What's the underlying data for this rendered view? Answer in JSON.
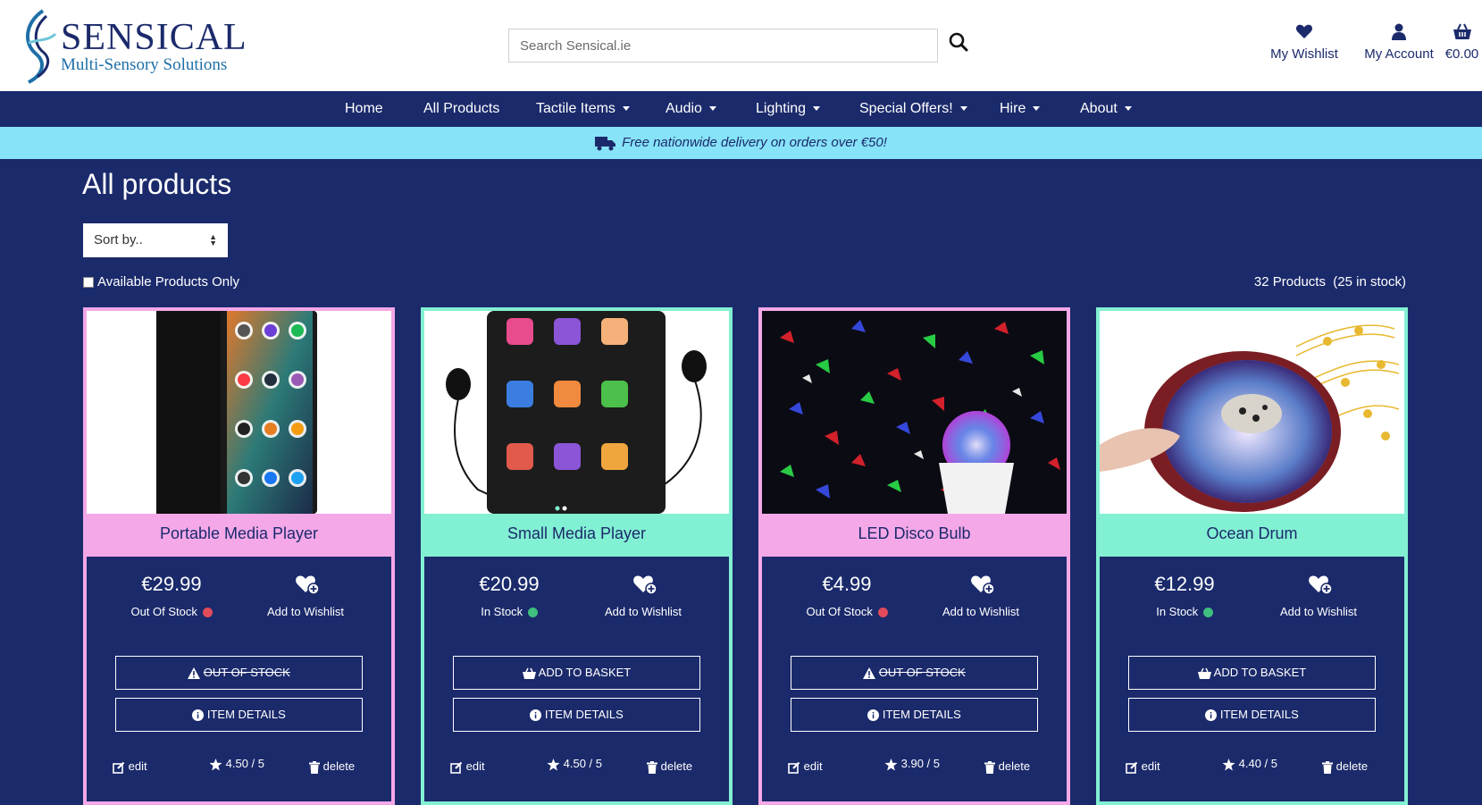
{
  "brand": {
    "name": "SENSICAL",
    "tagline": "Multi-Sensory Solutions"
  },
  "search": {
    "placeholder": "Search Sensical.ie"
  },
  "header_links": {
    "wishlist": "My Wishlist",
    "account": "My Account",
    "basket": "€0.00"
  },
  "nav": [
    {
      "label": "Home",
      "dropdown": false
    },
    {
      "label": "All Products",
      "dropdown": false
    },
    {
      "label": "Tactile Items",
      "dropdown": true
    },
    {
      "label": "Audio",
      "dropdown": true
    },
    {
      "label": "Lighting",
      "dropdown": true
    },
    {
      "label": "Special Offers!",
      "dropdown": true
    },
    {
      "label": "Hire",
      "dropdown": true
    },
    {
      "label": "About",
      "dropdown": true
    }
  ],
  "banner": "Free nationwide delivery on orders over €50!",
  "page": {
    "title": "All products",
    "sort_value": "Sort by..",
    "available_only_label": "Available Products Only",
    "product_count": "32 Products",
    "stock_count": "(25 in stock)"
  },
  "colors": {
    "navy": "#1b2a6b",
    "pink": "#f4a8e8",
    "mint": "#82f0d3",
    "banner": "#87e3f8"
  },
  "products": [
    {
      "name": "Portable Media Player",
      "price": "€29.99",
      "stock": "Out Of Stock",
      "in_stock": false,
      "wishlist_label": "Add to Wishlist",
      "primary_button": "Out of Stock",
      "details_button": "Item Details",
      "edit_label": "edit",
      "rating": "4.50 / 5",
      "delete_label": "delete",
      "theme": "pink"
    },
    {
      "name": "Small Media Player",
      "price": "€20.99",
      "stock": "In Stock",
      "in_stock": true,
      "wishlist_label": "Add to Wishlist",
      "primary_button": "Add to Basket",
      "details_button": "Item Details",
      "edit_label": "edit",
      "rating": "4.50 / 5",
      "delete_label": "delete",
      "theme": "mint"
    },
    {
      "name": "LED Disco Bulb",
      "price": "€4.99",
      "stock": "Out Of Stock",
      "in_stock": false,
      "wishlist_label": "Add to Wishlist",
      "primary_button": "Out of Stock",
      "details_button": "Item Details",
      "edit_label": "edit",
      "rating": "3.90 / 5",
      "delete_label": "delete",
      "theme": "pink"
    },
    {
      "name": "Ocean Drum",
      "price": "€12.99",
      "stock": "In Stock",
      "in_stock": true,
      "wishlist_label": "Add to Wishlist",
      "primary_button": "Add to Basket",
      "details_button": "Item Details",
      "edit_label": "edit",
      "rating": "4.40 / 5",
      "delete_label": "delete",
      "theme": "mint"
    }
  ]
}
